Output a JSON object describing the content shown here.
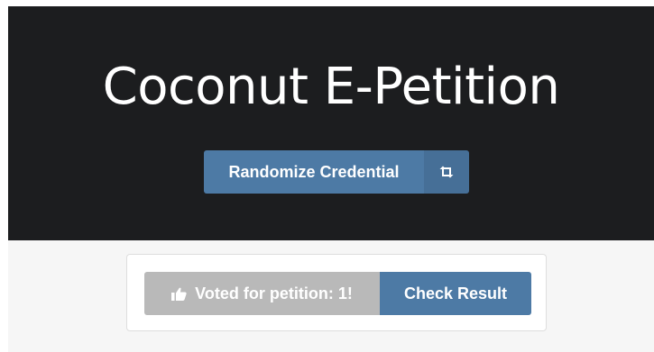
{
  "header": {
    "title": "Coconut E-Petition"
  },
  "credential": {
    "randomize_label": "Randomize Credential",
    "randomize_icon": "retweet-icon"
  },
  "vote": {
    "status_label": "Voted for petition: 1!",
    "status_icon": "thumbs-up-icon",
    "status_enabled": false,
    "check_result_label": "Check Result"
  },
  "colors": {
    "hero_background": "#1c1d1f",
    "primary_button": "#4d7aa5",
    "disabled_button": "#b9b9b9",
    "page_background": "#f6f6f6"
  }
}
